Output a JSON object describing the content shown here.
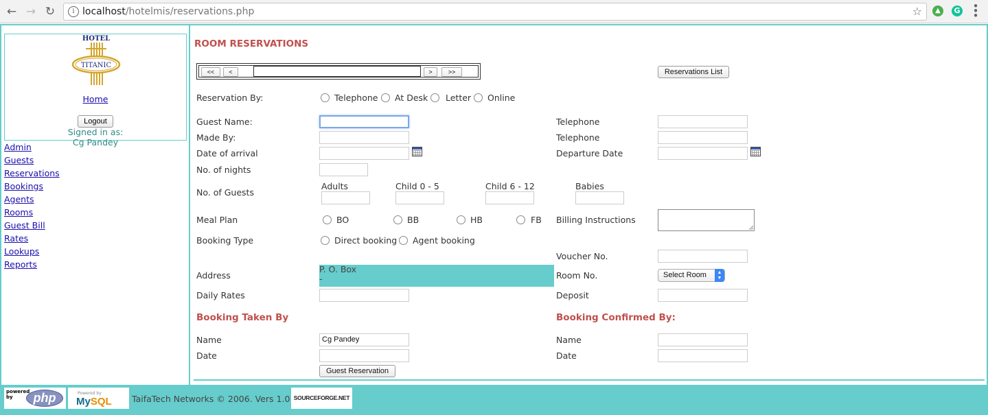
{
  "browser": {
    "url_host": "localhost",
    "url_path": "/hotelmis/reservations.php"
  },
  "sidebar": {
    "logo_text_top": "HOTEL",
    "logo_text_oval": "TITANIC",
    "home_label": "Home",
    "logout_label": "Logout",
    "signed_in_label": "Signed in as:",
    "signed_in_user": "Cg Pandey",
    "menu": [
      {
        "label": "Admin"
      },
      {
        "label": "Guests"
      },
      {
        "label": "Reservations"
      },
      {
        "label": "Bookings"
      },
      {
        "label": "Agents"
      },
      {
        "label": "Rooms"
      },
      {
        "label": "Guest Bill"
      },
      {
        "label": "Rates"
      },
      {
        "label": "Lookups"
      },
      {
        "label": "Reports"
      }
    ]
  },
  "main": {
    "title": "ROOM RESERVATIONS",
    "pager": {
      "first": "<<",
      "prev": "<",
      "next": ">",
      "last": ">>"
    },
    "reservations_list_label": "Reservations List",
    "reservation_by": {
      "label": "Reservation By:",
      "options": [
        "Telephone",
        "At Desk",
        "Letter",
        "Online"
      ]
    },
    "guest_name_label": "Guest Name:",
    "made_by_label": "Made By:",
    "date_of_arrival_label": "Date of arrival",
    "no_of_nights_label": "No. of nights",
    "telephone_label_1": "Telephone",
    "telephone_label_2": "Telephone",
    "departure_date_label": "Departure Date",
    "no_of_guests_label": "No. of Guests",
    "guest_columns": [
      "Adults",
      "Child 0 - 5",
      "Child 6 - 12",
      "Babies"
    ],
    "meal_plan": {
      "label": "Meal Plan",
      "options": [
        "BO",
        "BB",
        "HB",
        "FB"
      ]
    },
    "billing_instructions_label": "Billing Instructions",
    "booking_type": {
      "label": "Booking Type",
      "options": [
        "Direct booking",
        "Agent booking"
      ]
    },
    "voucher_no_label": "Voucher No.",
    "address_label": "Address",
    "address_line1": "P. O. Box",
    "address_line2": "-",
    "room_no_label": "Room No.",
    "room_select_value": "Select Room",
    "daily_rates_label": "Daily Rates",
    "deposit_label": "Deposit",
    "booking_taken_by": {
      "heading": "Booking Taken By",
      "name_label": "Name",
      "name_value": "Cg Pandey",
      "date_label": "Date"
    },
    "booking_confirmed_by": {
      "heading": "Booking Confirmed By:",
      "name_label": "Name",
      "date_label": "Date"
    },
    "submit_label": "Guest Reservation"
  },
  "footer": {
    "php_powered": "powered by",
    "php_logo": "php",
    "mysql_powered": "Powered by",
    "mysql_my": "My",
    "mysql_sql": "SQL",
    "text": "TaifaTech Networks © 2006. Vers 1.0",
    "sourceforge": "SOURCEFORGE.NET"
  },
  "colors": {
    "accent": "#66cccc",
    "heading": "#c0504d",
    "link": "#1a0dab"
  }
}
